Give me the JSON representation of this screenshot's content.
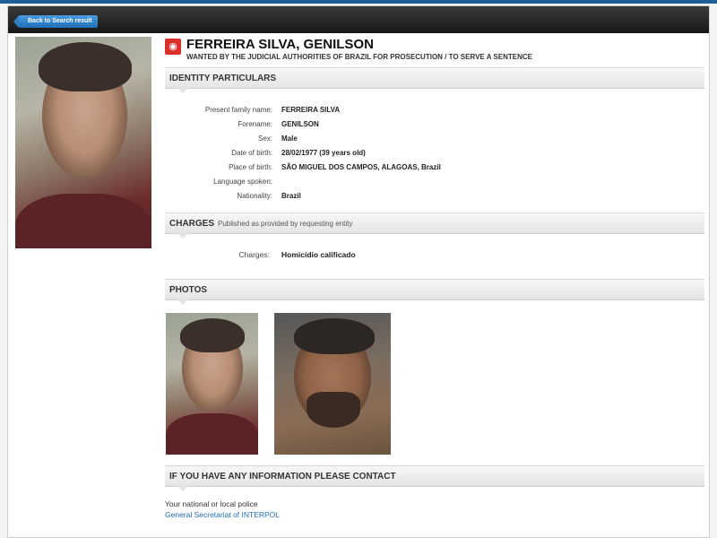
{
  "nav": {
    "back_label": "Back to Search result"
  },
  "notice": {
    "name": "FERREIRA SILVA, GENILSON",
    "wanted_by": "WANTED BY THE JUDICIAL AUTHORITIES OF BRAZIL FOR PROSECUTION / TO SERVE A SENTENCE"
  },
  "identity": {
    "heading": "IDENTITY PARTICULARS",
    "rows": [
      {
        "label": "Present family name:",
        "value": "FERREIRA SILVA"
      },
      {
        "label": "Forename:",
        "value": "GENILSON"
      },
      {
        "label": "Sex:",
        "value": "Male"
      },
      {
        "label": "Date of birth:",
        "value": "28/02/1977 (39 years old)"
      },
      {
        "label": "Place of birth:",
        "value": "SÃO MIGUEL DOS CAMPOS, ALAGOAS, Brazil"
      },
      {
        "label": "Language spoken:",
        "value": ""
      },
      {
        "label": "Nationality:",
        "value": "Brazil"
      }
    ]
  },
  "charges": {
    "heading": "CHARGES",
    "subheading": "Published as provided by requesting entity",
    "label": "Charges:",
    "value": "Homicídio calificado"
  },
  "photos": {
    "heading": "PHOTOS"
  },
  "contact": {
    "heading": "IF YOU HAVE ANY INFORMATION PLEASE CONTACT",
    "line1": "Your national or local police",
    "line2": "General Secretariat of INTERPOL"
  },
  "colors": {
    "accent": "#1f6fb9",
    "logo": "#d9302b",
    "titlebar": "#171717"
  }
}
